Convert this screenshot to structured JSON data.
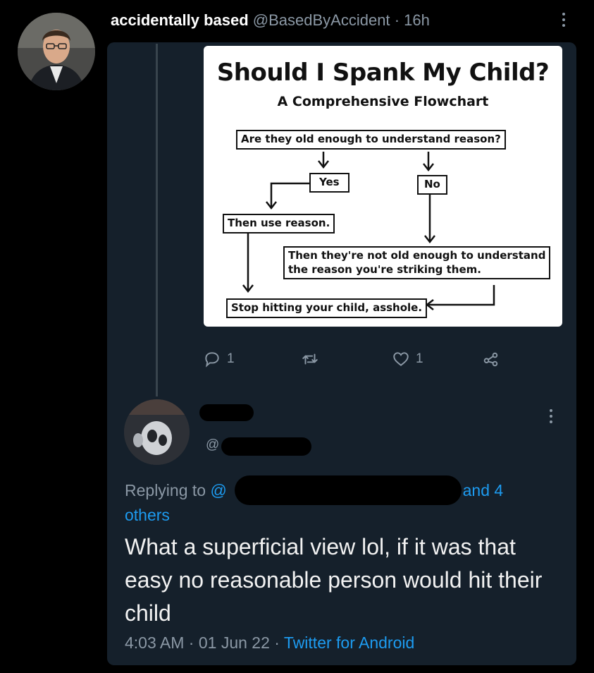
{
  "tweet": {
    "display_name": "accidentally based",
    "handle": "@BasedByAccident",
    "separator": "·",
    "age": "16h",
    "flowchart": {
      "title": "Should I Spank My Child?",
      "subtitle": "A Comprehensive Flowchart",
      "nodes": {
        "question": "Are they old enough to understand reason?",
        "yes": "Yes",
        "no": "No",
        "use_reason": "Then use reason.",
        "not_old_line1": "Then they're not old enough to understand",
        "not_old_line2": "the reason you're striking them.",
        "stop": "Stop hitting your child, asshole."
      }
    },
    "actions": {
      "reply_count": "1",
      "retweet_count": "",
      "like_count": "1"
    }
  },
  "reply": {
    "handle_prefix": "@",
    "replying_prefix": "Replying to",
    "mention_prefix": "@",
    "others_text": "and 4",
    "others_text2": "others",
    "text": "What a superficial view lol, if it was that easy no reasonable person would hit their child",
    "time": "4:03 AM",
    "date": "01 Jun 22",
    "source": "Twitter for Android",
    "separator": "·"
  },
  "colors": {
    "background": "#000000",
    "panel": "#15202b",
    "muted": "#8b98a5",
    "accent": "#1d9bf0"
  }
}
